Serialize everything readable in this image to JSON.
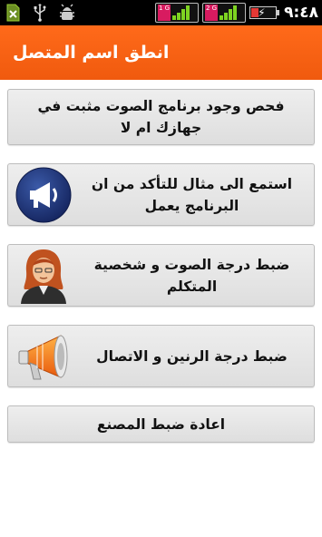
{
  "status_bar": {
    "left_icons": [
      "sd-card-error-icon",
      "usb-icon",
      "android-debug-icon"
    ],
    "sim1_tag": "1 G",
    "sim2_tag": "2 G",
    "battery_level": 0.3,
    "time": "٩:٤٨"
  },
  "header": {
    "title": "انطق اسم المتصل",
    "color": "#f25e10"
  },
  "menu": [
    {
      "label": "فحص وجود برنامج الصوت مثبت في جهازك ام لا",
      "icon": null
    },
    {
      "label": "استمع الى مثال للتأكد من ان البرنامج يعمل",
      "icon": "megaphone-circle-icon"
    },
    {
      "label": "ضبط درجة الصوت و شخصية المتكلم",
      "icon": "woman-avatar-icon"
    },
    {
      "label": "ضبط درجة الرنين و الاتصال",
      "icon": "orange-megaphone-icon"
    },
    {
      "label": "اعادة ضبط المصنع",
      "icon": null
    }
  ]
}
